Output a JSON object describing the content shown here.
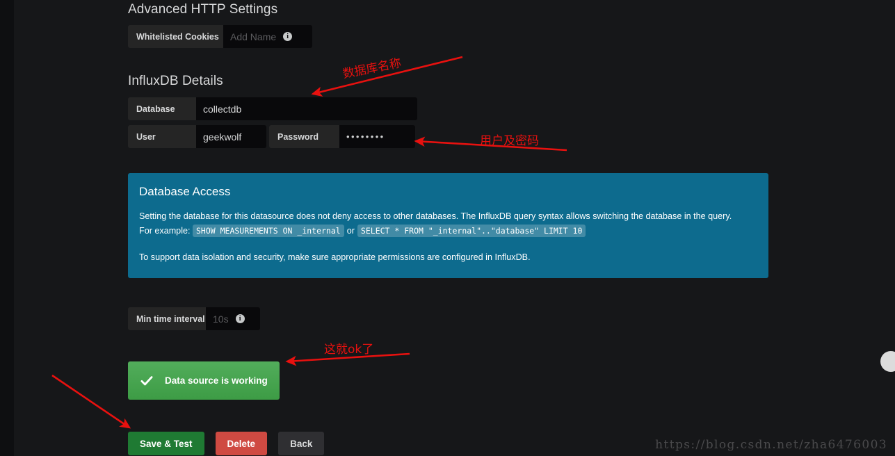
{
  "page": {
    "background_color": "#161719",
    "watermark": "https://blog.csdn.net/zha6476003"
  },
  "advanced_http": {
    "heading": "Advanced HTTP Settings",
    "whitelisted_cookies": {
      "label": "Whitelisted Cookies",
      "value": "",
      "placeholder": "Add Name",
      "info_icon": "info-icon"
    }
  },
  "influxdb_details": {
    "heading": "InfluxDB Details",
    "database": {
      "label": "Database",
      "value": "collectdb",
      "placeholder": ""
    },
    "user": {
      "label": "User",
      "value": "geekwolf",
      "placeholder": ""
    },
    "password": {
      "label": "Password",
      "value": "••••••••",
      "placeholder": ""
    }
  },
  "database_access": {
    "title": "Database Access",
    "paragraph1": "Setting the database for this datasource does not deny access to other databases. The InfluxDB query syntax allows switching the database in the query.",
    "example_prefix": "For example:",
    "example_code_1": "SHOW MEASUREMENTS ON _internal",
    "example_or": "or",
    "example_code_2": "SELECT * FROM \"_internal\"..\"database\" LIMIT 10",
    "paragraph2": "To support data isolation and security, make sure appropriate permissions are configured in InfluxDB.",
    "background_color": "#0d6b8e"
  },
  "min_time_interval": {
    "label": "Min time interval",
    "value": "",
    "placeholder": "10s",
    "info_icon": "info-icon"
  },
  "status_alert": {
    "text": "Data source is working",
    "icon": "check-icon",
    "color": "#3d9c45"
  },
  "actions": {
    "save_test": "Save & Test",
    "delete": "Delete",
    "back": "Back",
    "save_color": "#1f7a33",
    "delete_color": "#cf4a42",
    "back_color": "#2f2f32"
  },
  "annotations": {
    "color": "#e8110f",
    "database_name": "数据库名称",
    "user_password": "用户及密码",
    "this_is_ok": "这就ok了"
  }
}
